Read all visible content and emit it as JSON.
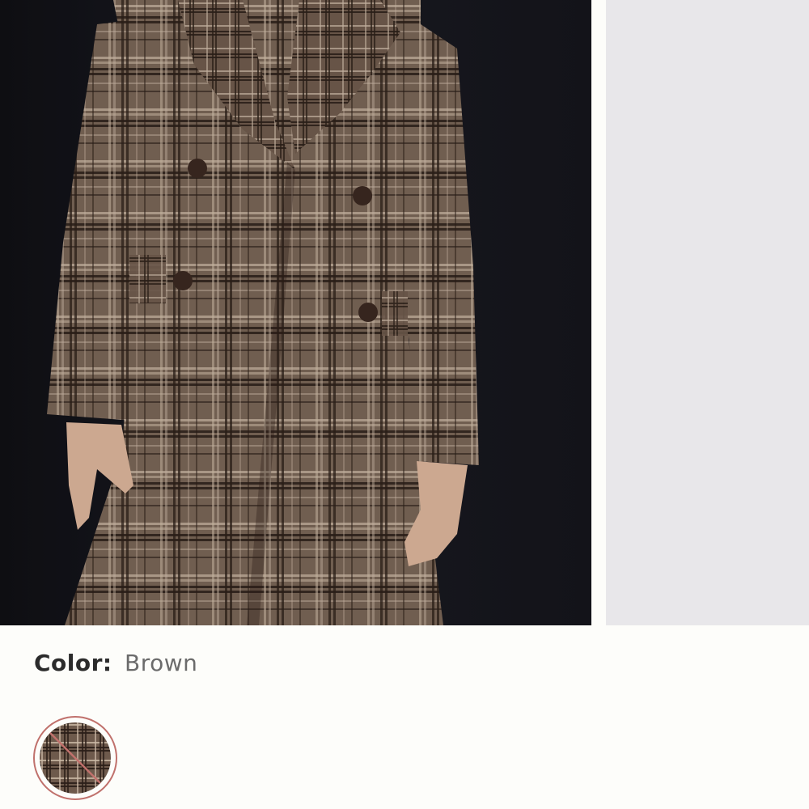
{
  "product": {
    "images": [
      {
        "alt": "plaid-double-breasted-coat-photo"
      },
      {
        "alt": "next-product-photo"
      }
    ],
    "color": {
      "label": "Color:",
      "value": "Brown"
    },
    "swatches": [
      {
        "name": "brown-plaid",
        "selected": true,
        "unavailable": true
      }
    ]
  },
  "colors": {
    "background": "#fdfdfa",
    "photo_backdrop": "#15151b",
    "coat_base": "#6e5a4c",
    "coat_check_dark": "#2a1e18",
    "coat_check_light": "#cdbba8",
    "swatch_ring": "#c0716c",
    "next_slide_bg": "#e8e7ea",
    "label_text": "#2b2b2b",
    "value_text": "#6b6b6b"
  }
}
